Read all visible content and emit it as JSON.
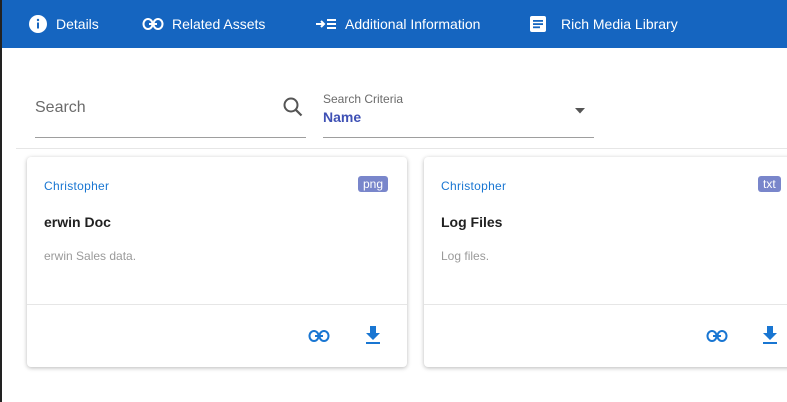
{
  "tabs": [
    {
      "label": "Details",
      "icon": "info-icon"
    },
    {
      "label": "Related Assets",
      "icon": "link-icon"
    },
    {
      "label": "Additional Information",
      "icon": "arrow-list-icon"
    },
    {
      "label": "Rich Media Library",
      "icon": "document-icon"
    }
  ],
  "search": {
    "placeholder": "Search",
    "value": ""
  },
  "criteria": {
    "label": "Search Criteria",
    "value": "Name"
  },
  "cards": [
    {
      "owner": "Christopher",
      "badge": "png",
      "title": "erwin Doc",
      "description": "erwin Sales data."
    },
    {
      "owner": "Christopher",
      "badge": "txt",
      "title": "Log Files",
      "description": "Log files."
    }
  ],
  "colors": {
    "tabbar": "#1565c0",
    "accent": "#1976d2",
    "criteria_value": "#3f51b5",
    "badge": "#7986cb"
  }
}
